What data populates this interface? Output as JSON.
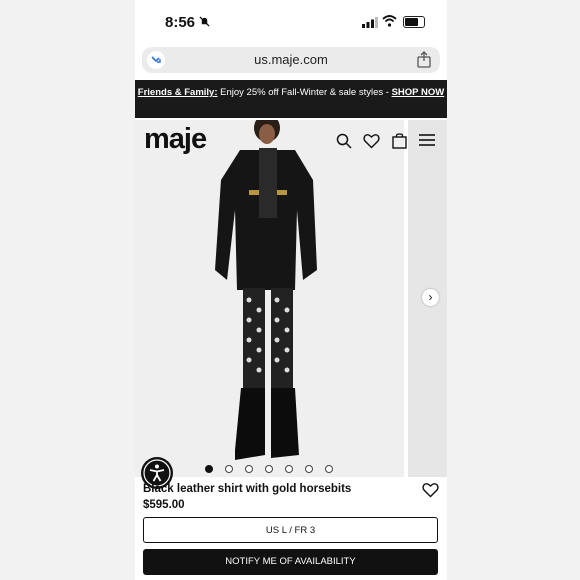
{
  "status": {
    "time": "8:56"
  },
  "browser": {
    "url": "us.maje.com"
  },
  "promo": {
    "lead": "Friends & Family:",
    "text": " Enjoy 25% off Fall-Winter & sale styles - ",
    "cta": "SHOP NOW"
  },
  "header": {
    "logo": "maje"
  },
  "carousel": {
    "total_dots": 7,
    "active_index": 0
  },
  "product": {
    "name": "Black leather shirt with gold horsebits",
    "price": "$595.00",
    "size_label": "US L / FR 3",
    "notify_label": "NOTIFY ME OF AVAILABILITY"
  },
  "icons": [
    "bell-muted-icon",
    "signal-icon",
    "wifi-icon",
    "battery-icon",
    "site-icon",
    "share-icon",
    "search-icon",
    "heart-icon",
    "bag-icon",
    "menu-icon",
    "chevron-right-icon",
    "accessibility-icon"
  ]
}
